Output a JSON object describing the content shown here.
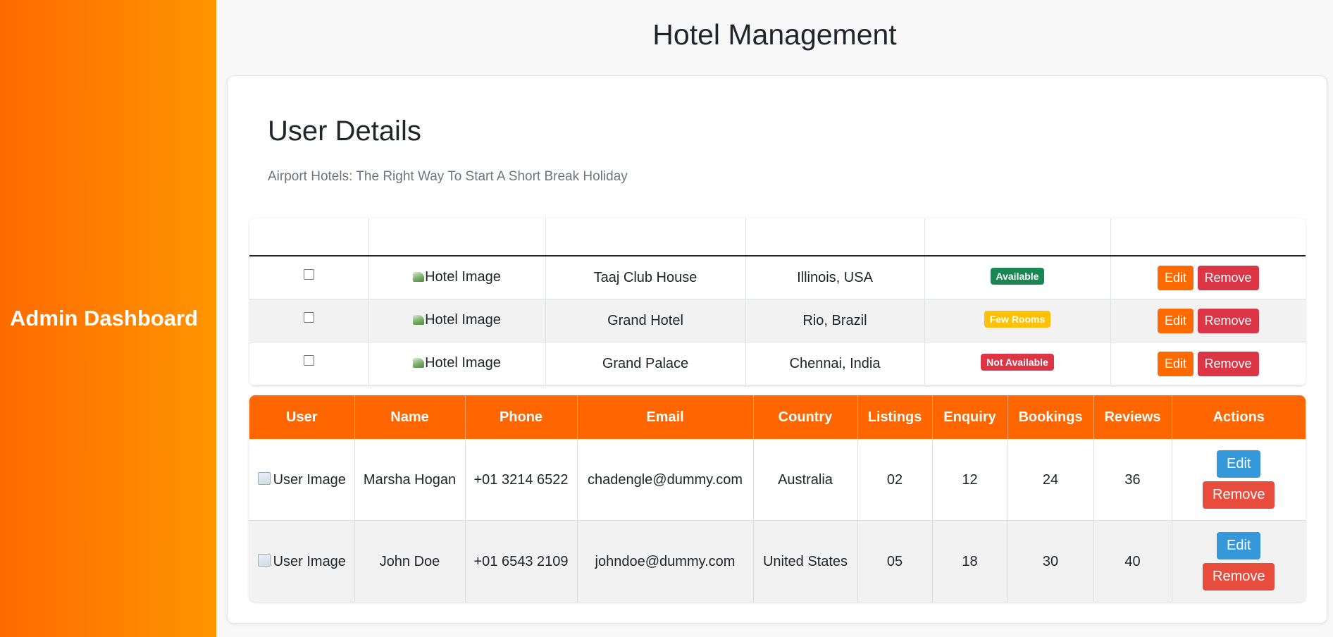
{
  "sidebar": {
    "title": "Admin Dashboard"
  },
  "header": {
    "title": "Hotel Management"
  },
  "card": {
    "heading": "User Details",
    "subtitle": "Airport Hotels: The Right Way To Start A Short Break Holiday"
  },
  "hotels": {
    "rows": [
      {
        "image_alt": "Hotel Image",
        "name": "Taaj Club House",
        "location": "Illinois, USA",
        "status": "Available",
        "status_color": "#198754",
        "edit": "Edit",
        "remove": "Remove"
      },
      {
        "image_alt": "Hotel Image",
        "name": "Grand Hotel",
        "location": "Rio, Brazil",
        "status": "Few Rooms",
        "status_color": "#ffc107",
        "edit": "Edit",
        "remove": "Remove"
      },
      {
        "image_alt": "Hotel Image",
        "name": "Grand Palace",
        "location": "Chennai, India",
        "status": "Not Available",
        "status_color": "#dc3545",
        "edit": "Edit",
        "remove": "Remove"
      }
    ]
  },
  "users": {
    "columns": [
      "User",
      "Name",
      "Phone",
      "Email",
      "Country",
      "Listings",
      "Enquiry",
      "Bookings",
      "Reviews",
      "Actions"
    ],
    "rows": [
      {
        "image_alt": "User Image",
        "name": "Marsha Hogan",
        "phone": "+01 3214 6522",
        "email": "chadengle@dummy.com",
        "country": "Australia",
        "listings": "02",
        "enquiry": "12",
        "bookings": "24",
        "reviews": "36",
        "edit": "Edit",
        "remove": "Remove"
      },
      {
        "image_alt": "User Image",
        "name": "John Doe",
        "phone": "+01 6543 2109",
        "email": "johndoe@dummy.com",
        "country": "United States",
        "listings": "05",
        "enquiry": "18",
        "bookings": "30",
        "reviews": "40",
        "edit": "Edit",
        "remove": "Remove"
      }
    ]
  },
  "colors": {
    "sidebar_gradient_start": "#ff6a00",
    "sidebar_gradient_end": "#ff9500",
    "users_header": "#ff6600",
    "edit_orange": "#ff6a00",
    "remove_red": "#dc3545",
    "edit_blue": "#3498db",
    "remove_red_alt": "#e74c3c"
  }
}
